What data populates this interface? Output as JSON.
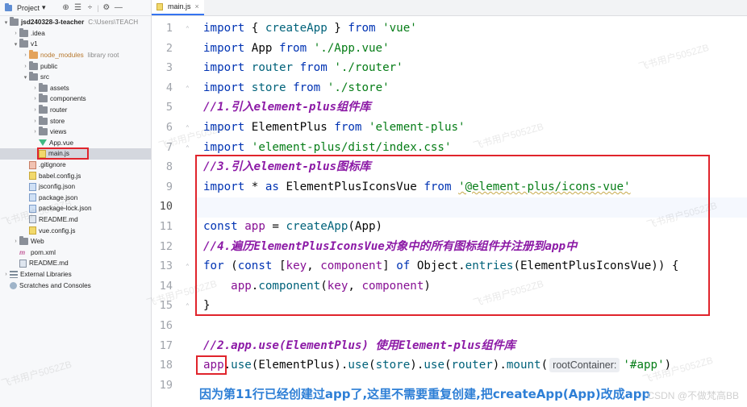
{
  "panel": {
    "title": "Project",
    "title_arrow": "▾",
    "tools": [
      "⊕",
      "☰",
      "÷",
      "⚙",
      "—"
    ]
  },
  "tree": [
    {
      "indent": 0,
      "arrow": "▾",
      "icon": "folder",
      "label": "jsd240328-3-teacher",
      "extra": "C:\\Users\\TEACH",
      "bold": true
    },
    {
      "indent": 1,
      "arrow": "›",
      "icon": "folder",
      "label": ".idea"
    },
    {
      "indent": 1,
      "arrow": "▾",
      "icon": "folder",
      "label": "v1"
    },
    {
      "indent": 2,
      "arrow": "›",
      "icon": "folder-orange",
      "label": "node_modules",
      "extra": "library root",
      "orange": true
    },
    {
      "indent": 2,
      "arrow": "›",
      "icon": "folder",
      "label": "public"
    },
    {
      "indent": 2,
      "arrow": "▾",
      "icon": "folder",
      "label": "src"
    },
    {
      "indent": 3,
      "arrow": "›",
      "icon": "folder",
      "label": "assets"
    },
    {
      "indent": 3,
      "arrow": "›",
      "icon": "folder",
      "label": "components"
    },
    {
      "indent": 3,
      "arrow": "›",
      "icon": "folder",
      "label": "router"
    },
    {
      "indent": 3,
      "arrow": "›",
      "icon": "folder",
      "label": "store"
    },
    {
      "indent": 3,
      "arrow": "›",
      "icon": "folder",
      "label": "views"
    },
    {
      "indent": 3,
      "arrow": "",
      "icon": "vue",
      "label": "App.vue"
    },
    {
      "indent": 3,
      "arrow": "",
      "icon": "file-js",
      "label": "main.js",
      "selected": true
    },
    {
      "indent": 2,
      "arrow": "",
      "icon": "file-git",
      "label": ".gitignore"
    },
    {
      "indent": 2,
      "arrow": "",
      "icon": "file-js",
      "label": "babel.config.js"
    },
    {
      "indent": 2,
      "arrow": "",
      "icon": "file-json",
      "label": "jsconfig.json"
    },
    {
      "indent": 2,
      "arrow": "",
      "icon": "file-json",
      "label": "package.json"
    },
    {
      "indent": 2,
      "arrow": "",
      "icon": "file-json",
      "label": "package-lock.json"
    },
    {
      "indent": 2,
      "arrow": "",
      "icon": "file-md",
      "label": "README.md"
    },
    {
      "indent": 2,
      "arrow": "",
      "icon": "file-js",
      "label": "vue.config.js"
    },
    {
      "indent": 1,
      "arrow": "›",
      "icon": "folder",
      "label": "Web"
    },
    {
      "indent": 1,
      "arrow": "",
      "icon": "maven",
      "label": "pom.xml"
    },
    {
      "indent": 1,
      "arrow": "",
      "icon": "file-md",
      "label": "README.md"
    },
    {
      "indent": 0,
      "arrow": "›",
      "icon": "bars",
      "label": "External Libraries"
    },
    {
      "indent": 0,
      "arrow": "",
      "icon": "scratch",
      "label": "Scratches and Consoles"
    }
  ],
  "editor": {
    "tab_label": "main.js",
    "tab_close": "×",
    "current_line": 10,
    "lines": [
      {
        "n": "1",
        "parts": [
          {
            "t": "import",
            "c": "kw"
          },
          {
            "t": " { "
          },
          {
            "t": "createApp",
            "c": "fn"
          },
          {
            "t": " } "
          },
          {
            "t": "from",
            "c": "kw"
          },
          {
            "t": " "
          },
          {
            "t": "'vue'",
            "c": "str"
          }
        ]
      },
      {
        "n": "2",
        "parts": [
          {
            "t": "import",
            "c": "kw"
          },
          {
            "t": " App "
          },
          {
            "t": "from",
            "c": "kw"
          },
          {
            "t": " "
          },
          {
            "t": "'./App.vue'",
            "c": "str"
          }
        ]
      },
      {
        "n": "3",
        "parts": [
          {
            "t": "import",
            "c": "kw"
          },
          {
            "t": " "
          },
          {
            "t": "router",
            "c": "fn"
          },
          {
            "t": " "
          },
          {
            "t": "from",
            "c": "kw"
          },
          {
            "t": " "
          },
          {
            "t": "'./router'",
            "c": "str"
          }
        ]
      },
      {
        "n": "4",
        "parts": [
          {
            "t": "import",
            "c": "kw"
          },
          {
            "t": " "
          },
          {
            "t": "store",
            "c": "fn"
          },
          {
            "t": " "
          },
          {
            "t": "from",
            "c": "kw"
          },
          {
            "t": " "
          },
          {
            "t": "'./store'",
            "c": "str"
          }
        ]
      },
      {
        "n": "5",
        "parts": [
          {
            "t": "//1.引入element-plus组件库",
            "c": "cmt"
          }
        ]
      },
      {
        "n": "6",
        "parts": [
          {
            "t": "import",
            "c": "kw"
          },
          {
            "t": " ElementPlus "
          },
          {
            "t": "from",
            "c": "kw"
          },
          {
            "t": " "
          },
          {
            "t": "'element-plus'",
            "c": "str"
          }
        ]
      },
      {
        "n": "7",
        "parts": [
          {
            "t": "import",
            "c": "kw"
          },
          {
            "t": " "
          },
          {
            "t": "'element-plus/dist/index.css'",
            "c": "str"
          }
        ]
      },
      {
        "n": "8",
        "parts": [
          {
            "t": "//3.引入element-plus图标库",
            "c": "cmt"
          }
        ]
      },
      {
        "n": "9",
        "parts": [
          {
            "t": "import",
            "c": "kw"
          },
          {
            "t": " * "
          },
          {
            "t": "as",
            "c": "kw"
          },
          {
            "t": " ElementPlusIconsVue "
          },
          {
            "t": "from",
            "c": "kw"
          },
          {
            "t": " "
          },
          {
            "t": "'@element-plus/icons-vue'",
            "c": "str-wave"
          }
        ]
      },
      {
        "n": "10",
        "parts": []
      },
      {
        "n": "11",
        "parts": [
          {
            "t": "const",
            "c": "kw"
          },
          {
            "t": " "
          },
          {
            "t": "app",
            "c": "obj"
          },
          {
            "t": " = "
          },
          {
            "t": "createApp",
            "c": "fn"
          },
          {
            "t": "(App)"
          }
        ]
      },
      {
        "n": "12",
        "parts": [
          {
            "t": "//4.遍历ElementPlusIconsVue对象中的所有图标组件并注册到app中",
            "c": "cmt"
          }
        ]
      },
      {
        "n": "13",
        "parts": [
          {
            "t": "for",
            "c": "kw"
          },
          {
            "t": " ("
          },
          {
            "t": "const",
            "c": "kw"
          },
          {
            "t": " ["
          },
          {
            "t": "key",
            "c": "obj"
          },
          {
            "t": ", "
          },
          {
            "t": "component",
            "c": "obj"
          },
          {
            "t": "] "
          },
          {
            "t": "of",
            "c": "kw"
          },
          {
            "t": " Object."
          },
          {
            "t": "entries",
            "c": "fn"
          },
          {
            "t": "(ElementPlusIconsVue)) {"
          }
        ]
      },
      {
        "n": "14",
        "parts": [
          {
            "t": "    "
          },
          {
            "t": "app",
            "c": "obj"
          },
          {
            "t": "."
          },
          {
            "t": "component",
            "c": "fn"
          },
          {
            "t": "("
          },
          {
            "t": "key",
            "c": "obj"
          },
          {
            "t": ", "
          },
          {
            "t": "component",
            "c": "obj"
          },
          {
            "t": ")"
          }
        ]
      },
      {
        "n": "15",
        "parts": [
          {
            "t": "}"
          }
        ]
      },
      {
        "n": "16",
        "parts": []
      },
      {
        "n": "17",
        "parts": [
          {
            "t": "//2.app.use(ElementPlus) 使用Element-plus组件库",
            "c": "cmt"
          }
        ]
      },
      {
        "n": "18",
        "parts": [
          {
            "t": "app",
            "c": "obj"
          },
          {
            "t": "."
          },
          {
            "t": "use",
            "c": "fn"
          },
          {
            "t": "(ElementPlus)."
          },
          {
            "t": "use",
            "c": "fn"
          },
          {
            "t": "("
          },
          {
            "t": "store",
            "c": "fn"
          },
          {
            "t": ")."
          },
          {
            "t": "use",
            "c": "fn"
          },
          {
            "t": "("
          },
          {
            "t": "router",
            "c": "fn"
          },
          {
            "t": ")."
          },
          {
            "t": "mount",
            "c": "fn"
          },
          {
            "t": "("
          },
          {
            "t": "rootContainer:",
            "c": "hint"
          },
          {
            "t": "'#app'",
            "c": "str"
          },
          {
            "t": ")"
          }
        ]
      },
      {
        "n": "19",
        "parts": []
      }
    ]
  },
  "annotation": "因为第11行已经创建过app了,这里不需要重复创建,把createApp(App)改成app",
  "watermark": "飞书用户5052ZB",
  "csdn_mark": "CSDN @不做梵高BB",
  "colors": {
    "keyword": "#0033b3",
    "string": "#067d17",
    "comment": "#8c1aa6",
    "annotation": "#2e7fd6",
    "highlight_box": "#e0242c"
  }
}
